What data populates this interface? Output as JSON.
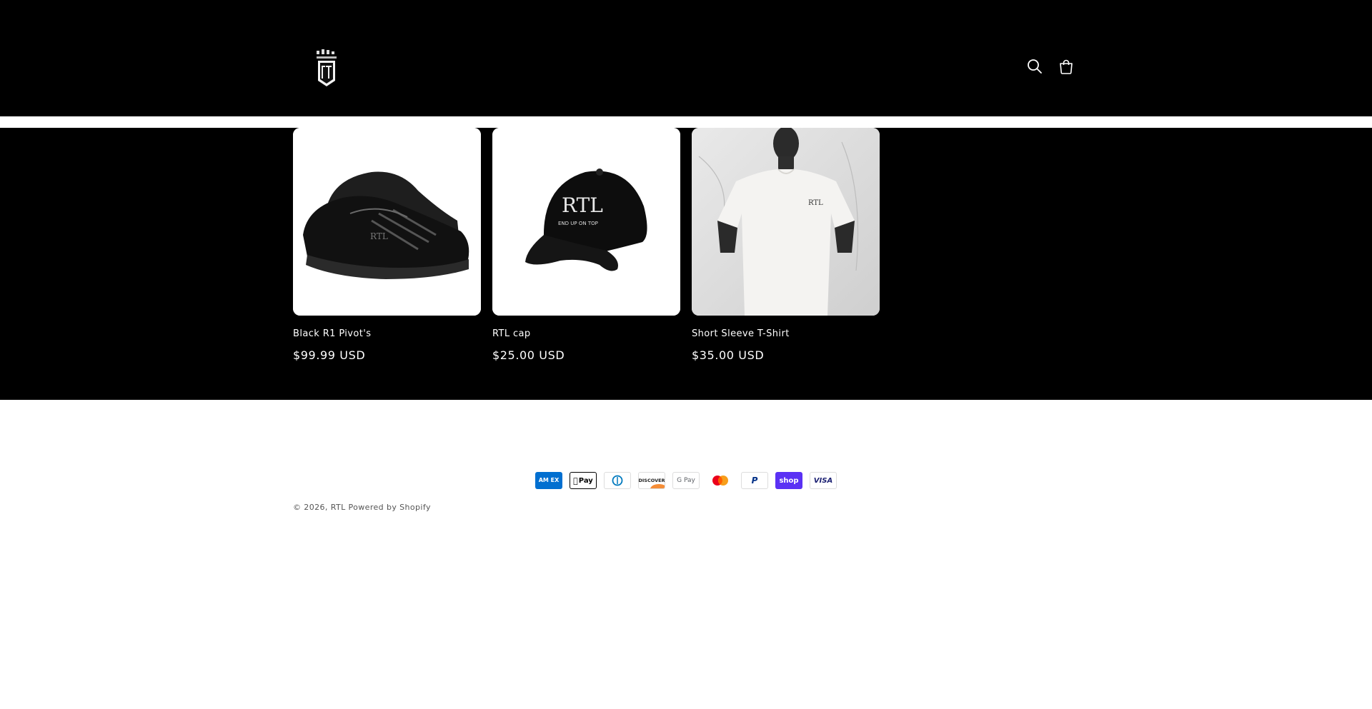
{
  "header": {
    "logo_alt": "RTL",
    "search_icon": "search-icon",
    "cart_icon": "cart-icon"
  },
  "products": [
    {
      "title": "Black R1 Pivot's",
      "price": "$99.99 USD",
      "image": "black-sneaker"
    },
    {
      "title": "RTL cap",
      "price": "$25.00 USD",
      "image": "black-cap"
    },
    {
      "title": "Short Sleeve T-Shirt",
      "price": "$35.00 USD",
      "image": "white-tshirt"
    }
  ],
  "payments": [
    {
      "name": "American Express",
      "icon": "amex-icon"
    },
    {
      "name": "Apple Pay",
      "icon": "apple-pay-icon"
    },
    {
      "name": "Diners Club",
      "icon": "diners-club-icon"
    },
    {
      "name": "Discover",
      "icon": "discover-icon"
    },
    {
      "name": "Google Pay",
      "icon": "google-pay-icon"
    },
    {
      "name": "Mastercard",
      "icon": "mastercard-icon"
    },
    {
      "name": "PayPal",
      "icon": "paypal-icon"
    },
    {
      "name": "Shop Pay",
      "icon": "shop-pay-icon"
    },
    {
      "name": "Visa",
      "icon": "visa-icon"
    }
  ],
  "payment_labels": {
    "amex": "AM EX",
    "apple": "Pay",
    "diners": "D",
    "discover": "DISCOVER",
    "gpay": "G Pay",
    "paypal": "P",
    "shop": "shop",
    "visa": "VISA"
  },
  "footer": {
    "copyright_prefix": "© 2026,",
    "store_link": "RTL",
    "powered_by": "Powered by Shopify"
  },
  "colors": {
    "header_bg": "#000000",
    "text_on_dark": "#ffffff",
    "footer_text": "#555555",
    "shop_pay": "#5a31f4",
    "amex": "#016fd0"
  }
}
